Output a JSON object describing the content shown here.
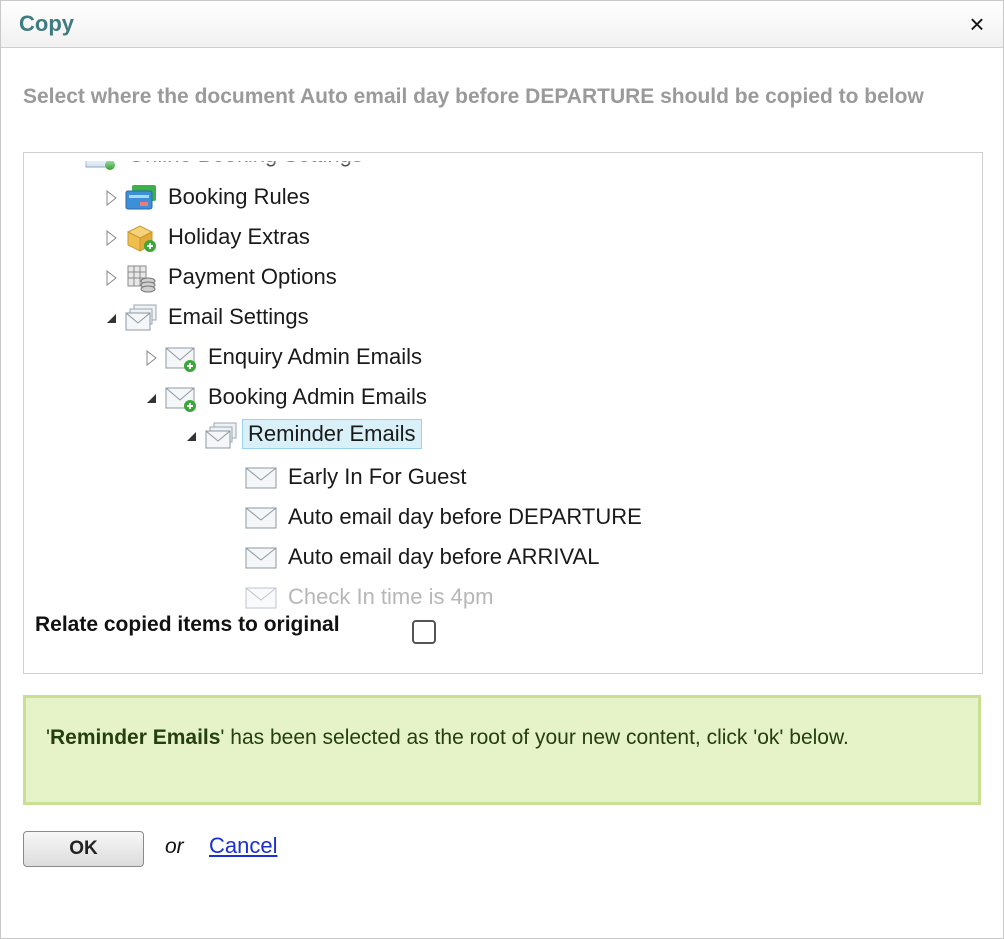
{
  "dialog": {
    "title": "Copy",
    "close_glyph": "×",
    "instruction": "Select where the document Auto email day before DEPARTURE should be copied to below"
  },
  "tree": {
    "nodes": [
      {
        "label": "Online Booking Settings",
        "icon": "settings-folder-icon",
        "state": "expanded"
      },
      {
        "label": "Booking Rules",
        "icon": "rules-card-icon",
        "state": "collapsed"
      },
      {
        "label": "Holiday Extras",
        "icon": "package-add-icon",
        "state": "collapsed"
      },
      {
        "label": "Payment Options",
        "icon": "payment-grid-icon",
        "state": "collapsed"
      },
      {
        "label": "Email Settings",
        "icon": "email-stack-icon",
        "state": "expanded"
      },
      {
        "label": "Enquiry Admin Emails",
        "icon": "email-add-icon",
        "state": "collapsed"
      },
      {
        "label": "Booking Admin Emails",
        "icon": "email-add-icon",
        "state": "expanded"
      },
      {
        "label": "Reminder Emails",
        "icon": "email-stack-icon",
        "state": "expanded",
        "selected": true
      },
      {
        "label": "Early In For Guest",
        "icon": "email-icon"
      },
      {
        "label": "Auto email day before DEPARTURE",
        "icon": "email-icon"
      },
      {
        "label": "Auto email day before ARRIVAL",
        "icon": "email-icon"
      },
      {
        "label": "Check In time is 4pm",
        "icon": "email-icon",
        "disabled": true
      }
    ]
  },
  "relate": {
    "label": "Relate copied items to original",
    "checked": false
  },
  "notice": {
    "quote_open": "'",
    "selected_name": "Reminder Emails",
    "message": "' has been selected as the root of your new content, click 'ok' below."
  },
  "actions": {
    "ok_label": "OK",
    "or_text": "or",
    "cancel_label": "Cancel"
  },
  "colors": {
    "title": "#3f7c7f",
    "selection_bg": "#daf0f8",
    "notice_bg": "#e6f2c8",
    "link": "#1a30d6"
  }
}
